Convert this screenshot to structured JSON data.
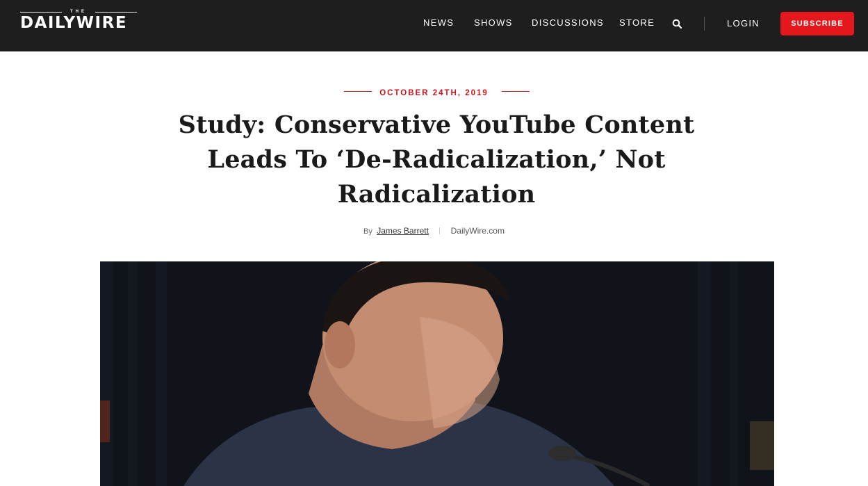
{
  "header": {
    "logo_top": "THE",
    "logo_word": "DAILYWIRE",
    "nav": {
      "news": "NEWS",
      "shows": "SHOWS",
      "discussions": "DISCUSSIONS",
      "store": "STORE",
      "login": "LOGIN",
      "subscribe": "SUBSCRIBE"
    },
    "icons": {
      "search": "search-icon"
    }
  },
  "article": {
    "date": "OCTOBER 24TH, 2019",
    "title": "Study: Conservative YouTube Content Leads To ‘De-Radicalization,’ Not Radicalization",
    "byline": {
      "by": "By",
      "author": "James Barrett",
      "source": "DailyWire.com"
    }
  },
  "colors": {
    "header_bg": "#1e1e1e",
    "accent_red": "#e4171d",
    "date_red": "#c8161c"
  }
}
